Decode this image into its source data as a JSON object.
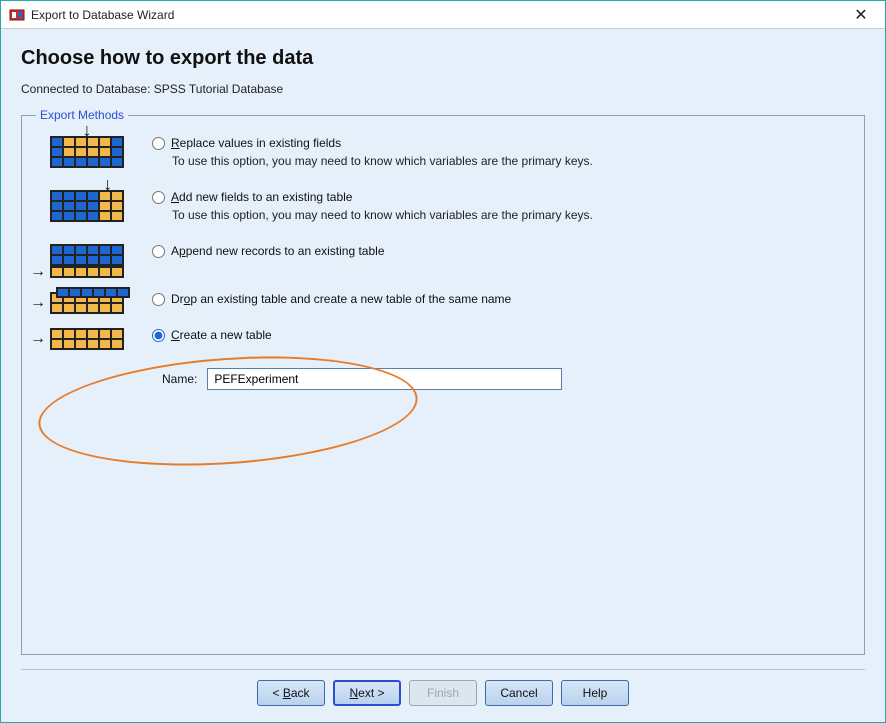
{
  "window": {
    "title": "Export to Database Wizard"
  },
  "page": {
    "heading": "Choose how to export the data",
    "connected_prefix": "Connected to Database: ",
    "database_name": "SPSS Tutorial Database"
  },
  "fieldset": {
    "legend": "Export Methods"
  },
  "options": {
    "replace": {
      "label": "Replace values in existing fields",
      "desc": "To use this option, you may need to know which variables are the primary keys."
    },
    "addfields": {
      "label": "Add new fields to an existing table",
      "desc": "To use this option, you may need to know which variables are the primary keys."
    },
    "append": {
      "label": "Append new records to an existing table"
    },
    "drop": {
      "label": "Drop an existing table and create a new table of the same name"
    },
    "create": {
      "label": "Create a new table"
    },
    "selected": "create"
  },
  "name_field": {
    "label": "Name:",
    "value": "PEFExperiment"
  },
  "buttons": {
    "back": "< Back",
    "next": "Next >",
    "finish": "Finish",
    "cancel": "Cancel",
    "help": "Help"
  }
}
